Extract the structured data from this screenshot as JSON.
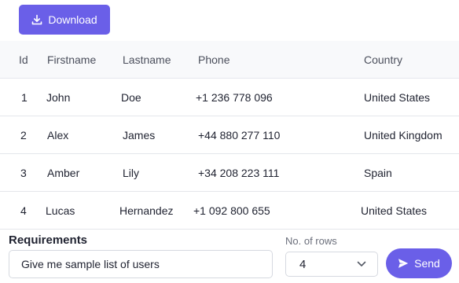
{
  "toolbar": {
    "download_label": "Download",
    "download_icon": "download-icon"
  },
  "table": {
    "headers": {
      "id": "Id",
      "firstname": "Firstname",
      "lastname": "Lastname",
      "phone": "Phone",
      "country": "Country"
    },
    "rows": [
      {
        "id": "1",
        "firstname": "John",
        "lastname": "Doe",
        "phone": "+1 236 778 096",
        "country": "United States"
      },
      {
        "id": "2",
        "firstname": "Alex",
        "lastname": "James",
        "phone": "+44 880 277 110",
        "country": "United Kingdom"
      },
      {
        "id": "3",
        "firstname": "Amber",
        "lastname": "Lily",
        "phone": "+34 208 223 111",
        "country": "Spain"
      },
      {
        "id": "4",
        "firstname": "Lucas",
        "lastname": "Hernandez",
        "phone": "+1 092 800 655",
        "country": "United States"
      }
    ]
  },
  "form": {
    "requirements_label": "Requirements",
    "requirements_value": "Give me sample list of users",
    "rows_label": "No. of rows",
    "rows_value": "4",
    "send_label": "Send",
    "send_icon": "send-icon"
  },
  "colors": {
    "accent": "#6a5fe8",
    "header_bg": "#f8f9fb",
    "border": "#e4e6eb"
  }
}
